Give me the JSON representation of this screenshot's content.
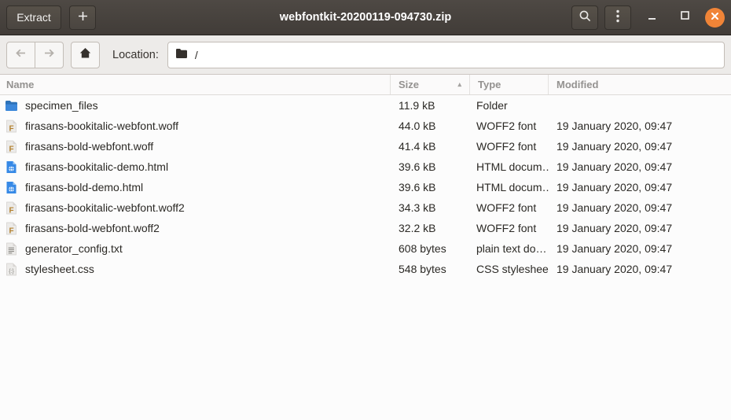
{
  "titlebar": {
    "extract_label": "Extract",
    "add_label": "+",
    "title": "webfontkit-20200119-094730.zip"
  },
  "toolbar": {
    "location_label": "Location:",
    "path": "/"
  },
  "table": {
    "headers": {
      "name": "Name",
      "size": "Size",
      "type": "Type",
      "modified": "Modified"
    },
    "sort": {
      "column": "Size",
      "direction": "ascending",
      "indicator": "▴"
    },
    "rows": [
      {
        "icon": "folder",
        "name": "specimen_files",
        "size": "11.9 kB",
        "type": "Folder",
        "modified": ""
      },
      {
        "icon": "font-file",
        "name": "firasans-bookitalic-webfont.woff",
        "size": "44.0 kB",
        "type": "WOFF2 font",
        "modified": "19 January 2020, 09:47"
      },
      {
        "icon": "font-file",
        "name": "firasans-bold-webfont.woff",
        "size": "41.4 kB",
        "type": "WOFF2 font",
        "modified": "19 January 2020, 09:47"
      },
      {
        "icon": "html-file",
        "name": "firasans-bookitalic-demo.html",
        "size": "39.6 kB",
        "type": "HTML docum…",
        "modified": "19 January 2020, 09:47"
      },
      {
        "icon": "html-file",
        "name": "firasans-bold-demo.html",
        "size": "39.6 kB",
        "type": "HTML docum…",
        "modified": "19 January 2020, 09:47"
      },
      {
        "icon": "font-file",
        "name": "firasans-bookitalic-webfont.woff2",
        "size": "34.3 kB",
        "type": "WOFF2 font",
        "modified": "19 January 2020, 09:47"
      },
      {
        "icon": "font-file",
        "name": "firasans-bold-webfont.woff2",
        "size": "32.2 kB",
        "type": "WOFF2 font",
        "modified": "19 January 2020, 09:47"
      },
      {
        "icon": "text-file",
        "name": "generator_config.txt",
        "size": "608 bytes",
        "type": "plain text do…",
        "modified": "19 January 2020, 09:47"
      },
      {
        "icon": "css-file",
        "name": "stylesheet.css",
        "size": "548 bytes",
        "type": "CSS stylesheet",
        "modified": "19 January 2020, 09:47"
      }
    ]
  },
  "icons": {
    "search": "magnifier",
    "menu": "vertical-ellipsis",
    "minimize": "horizontal-bar",
    "maximize": "square-outline",
    "close": "x-in-circle",
    "back": "arrow-left",
    "forward": "arrow-right",
    "home": "house",
    "location_folder": "folder",
    "sort": "triangle-up"
  },
  "colors": {
    "titlebar_bg": "#45403b",
    "close_button": "#f08437",
    "folder_icon_blue": "#3b87da",
    "html_icon_blue": "#3689e6",
    "font_letter": "#b3812e",
    "toolbar_bg": "#edebe9",
    "list_bg": "#fcfcfc"
  }
}
